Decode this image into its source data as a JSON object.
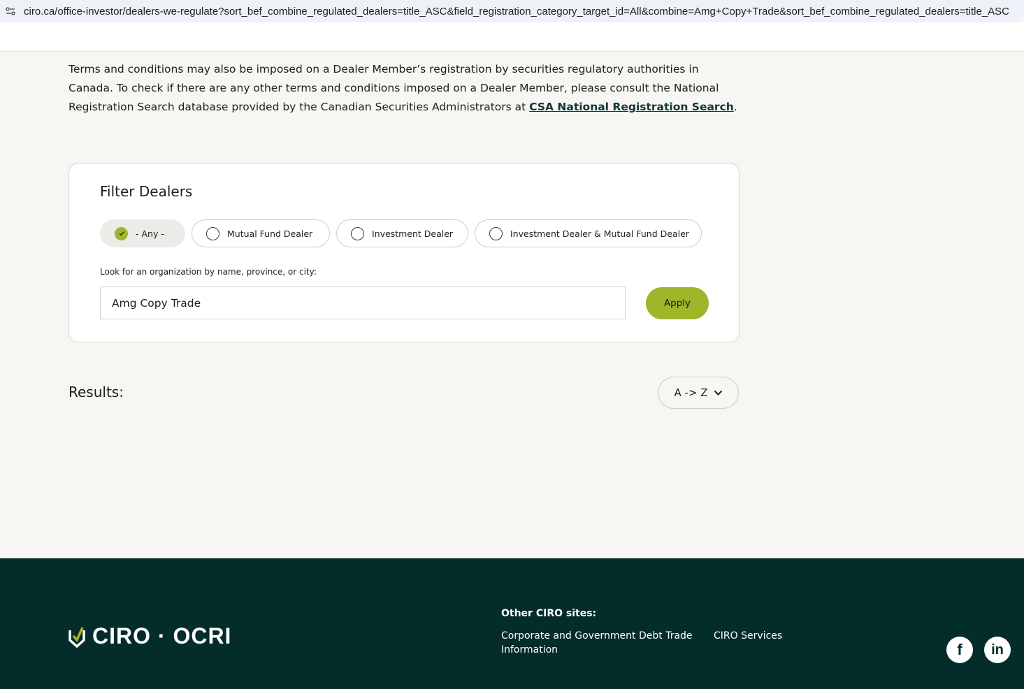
{
  "browser": {
    "url": "ciro.ca/office-investor/dealers-we-regulate?sort_bef_combine_regulated_dealers=title_ASC&field_registration_category_target_id=All&combine=Amg+Copy+Trade&sort_bef_combine_regulated_dealers=title_ASC"
  },
  "intro": {
    "text": "Terms and conditions may also be imposed on a Dealer Member’s registration by securities regulatory authorities in Canada. To check if there are any other terms and conditions imposed on a Dealer Member, please consult the National Registration Search database provided by the Canadian Securities Administrators at ",
    "link_text": "CSA National Registration Search",
    "end": "."
  },
  "filter": {
    "title": "Filter Dealers",
    "options": [
      {
        "label": "- Any -",
        "selected": true
      },
      {
        "label": "Mutual Fund Dealer",
        "selected": false
      },
      {
        "label": "Investment Dealer",
        "selected": false
      },
      {
        "label": "Investment Dealer & Mutual Fund Dealer",
        "selected": false
      }
    ],
    "search_label": "Look for an organization by name, province, or city:",
    "search_value": "Amg Copy Trade",
    "apply_label": "Apply"
  },
  "results": {
    "label": "Results:",
    "sort_label": "A -> Z"
  },
  "footer": {
    "logo_text": "CIRO · OCRI",
    "other_sites_title": "Other CIRO sites:",
    "links": [
      "Corporate and Government Debt Trade Information",
      "CIRO Services"
    ],
    "social": [
      {
        "icon": "facebook-icon",
        "glyph": "f"
      },
      {
        "icon": "linkedin-icon",
        "glyph": "in"
      }
    ]
  },
  "colors": {
    "accent": "#9fb52a",
    "footer_bg": "#032c2b",
    "link": "#0d3b36"
  }
}
